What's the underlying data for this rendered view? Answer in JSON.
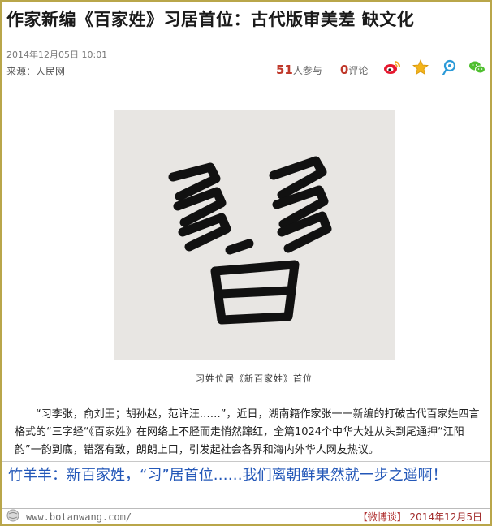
{
  "article": {
    "title": "作家新编《百家姓》习居首位：古代版审美差 缺文化",
    "date": "2014年12月05日  10:01",
    "source": "来源：人民网"
  },
  "stats": {
    "participants_count": "51",
    "participants_label": "人参与",
    "comments_count": "0",
    "comments_label": "评论"
  },
  "share": {
    "icons": [
      "weibo-icon",
      "star-icon",
      "tencent-weibo-icon",
      "wechat-icon"
    ]
  },
  "figure": {
    "calligraphy_char": "習",
    "caption": "习姓位居《新百家姓》首位"
  },
  "body": {
    "paragraph": "“习李张，俞刘王；胡孙赵，范许汪……”，近日，湖南籍作家张一一新编的打破古代百家姓四言格式的“三字经“《百家姓》在网络上不胫而走悄然蹿红，全篇1024个中华大姓从头到尾通押“江阳韵”一韵到底，错落有致，朗朗上口，引发起社会各界和海内外华人网友热议。"
  },
  "comment": {
    "text": "竹羊羊：新百家姓，“习”居首位……我们离朝鲜果然就一步之遥啊！"
  },
  "footer": {
    "site_url": "www.botanwang.com/",
    "tag": "【微博谈】",
    "date": "2014年12月5日"
  },
  "colors": {
    "frame": "#b9a64a",
    "comment_text": "#2357b8",
    "stat_number": "#c0392b"
  }
}
